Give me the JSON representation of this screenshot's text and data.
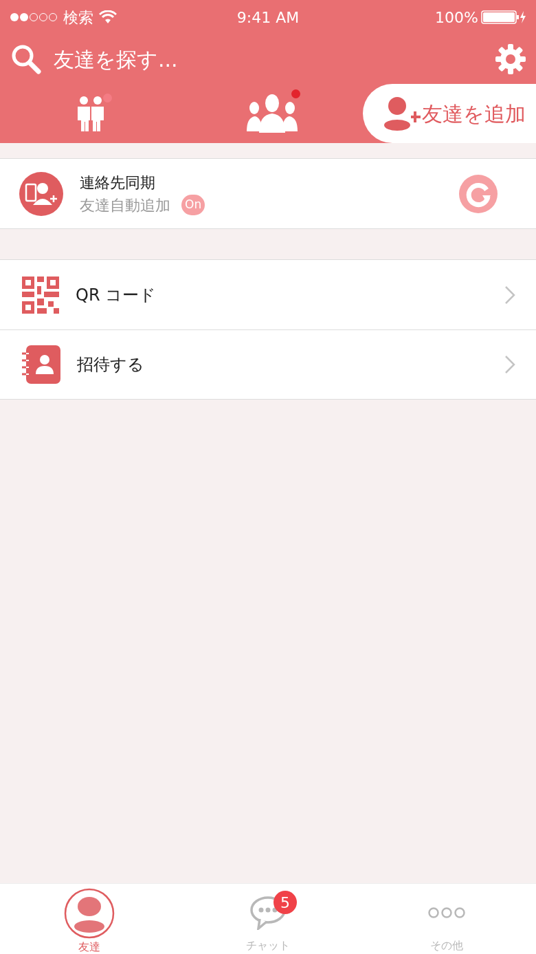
{
  "status_bar": {
    "carrier": "検索",
    "time": "9:41 AM",
    "battery": "100%"
  },
  "search": {
    "placeholder": "友達を探す..."
  },
  "tabs": [
    {
      "kind": "pair",
      "selected": false,
      "color": "#f47c84"
    },
    {
      "kind": "group",
      "selected": false,
      "color": "#e3232c"
    },
    {
      "kind": "add",
      "label": "友達を追加",
      "selected": true
    }
  ],
  "sync": {
    "title": "連絡先同期",
    "subtitle": "友達自動追加",
    "toggle": "On"
  },
  "menu": [
    {
      "kind": "qr",
      "label": "QR コード"
    },
    {
      "kind": "invite",
      "label": "招待する"
    }
  ],
  "bottom_tabs": [
    {
      "kind": "friends",
      "label": "友達",
      "selected": true
    },
    {
      "kind": "chat",
      "label": "チャット",
      "selected": false,
      "badge": "5"
    },
    {
      "kind": "more",
      "label": "その他",
      "selected": false
    }
  ]
}
